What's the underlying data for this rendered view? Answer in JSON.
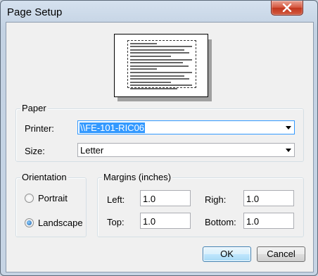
{
  "window": {
    "title": "Page Setup"
  },
  "preview": {
    "lines": 15
  },
  "paper": {
    "legend": "Paper",
    "printer_label": "Printer:",
    "printer_value": "\\\\FE-101-RIC06",
    "size_label": "Size:",
    "size_value": "Letter"
  },
  "orientation": {
    "legend": "Orientation",
    "portrait_label": "Portrait",
    "landscape_label": "Landscape",
    "selected": "Landscape"
  },
  "margins": {
    "legend": "Margins (inches)",
    "left_label": "Left:",
    "left_value": "1.0",
    "right_label": "Righ:",
    "right_value": "1.0",
    "top_label": "Top:",
    "top_value": "1.0",
    "bottom_label": "Bottom:",
    "bottom_value": "1.0"
  },
  "buttons": {
    "ok": "OK",
    "cancel": "Cancel"
  },
  "colors": {
    "accent": "#3399ff",
    "close": "#c2371f"
  }
}
